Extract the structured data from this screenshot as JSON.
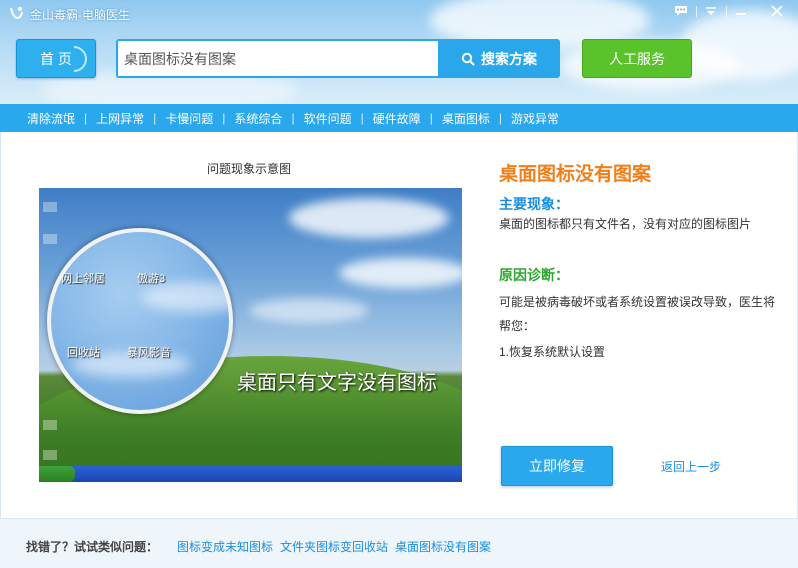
{
  "app": {
    "title": "金山毒霸-电脑医生"
  },
  "titlebar": {
    "icons": [
      "chat-icon",
      "dropdown-icon",
      "minimize-icon",
      "close-icon"
    ]
  },
  "header": {
    "home_label": "首 页",
    "search_value": "桌面图标没有图案",
    "search_button": "搜索方案",
    "human_service": "人工服务"
  },
  "catnav": {
    "items": [
      "清除流氓",
      "上网异常",
      "卡慢问题",
      "系统综合",
      "软件问题",
      "硬件故障",
      "桌面图标",
      "游戏异常"
    ]
  },
  "figure": {
    "caption": "问题现象示意图",
    "magnifier_labels": [
      "网上邻居",
      "傲游3",
      "回收站",
      "暴风影音"
    ],
    "overlay_text": "桌面只有文字没有图标"
  },
  "detail": {
    "title": "桌面图标没有图案",
    "symptom_heading": "主要现象：",
    "symptom_text": "桌面的图标都只有文件名，没有对应的图标图片",
    "diagnosis_heading": "原因诊断：",
    "diagnosis_line1": "可能是被病毒破坏或者系统设置被误改导致，医生将",
    "diagnosis_line2": "帮您：",
    "diagnosis_line3": "1.恢复系统默认设置",
    "fix_button": "立即修复",
    "back_link": "返回上一步"
  },
  "footer": {
    "label": "找错了？试试类似问题：",
    "links": [
      "图标变成未知图标",
      "文件夹图标变回收站",
      "桌面图标没有图案"
    ]
  },
  "colors": {
    "accent_blue": "#2aa8ee",
    "green_button": "#5ac32b",
    "title_orange": "#f07f1a",
    "heading_green": "#2fa62f"
  }
}
